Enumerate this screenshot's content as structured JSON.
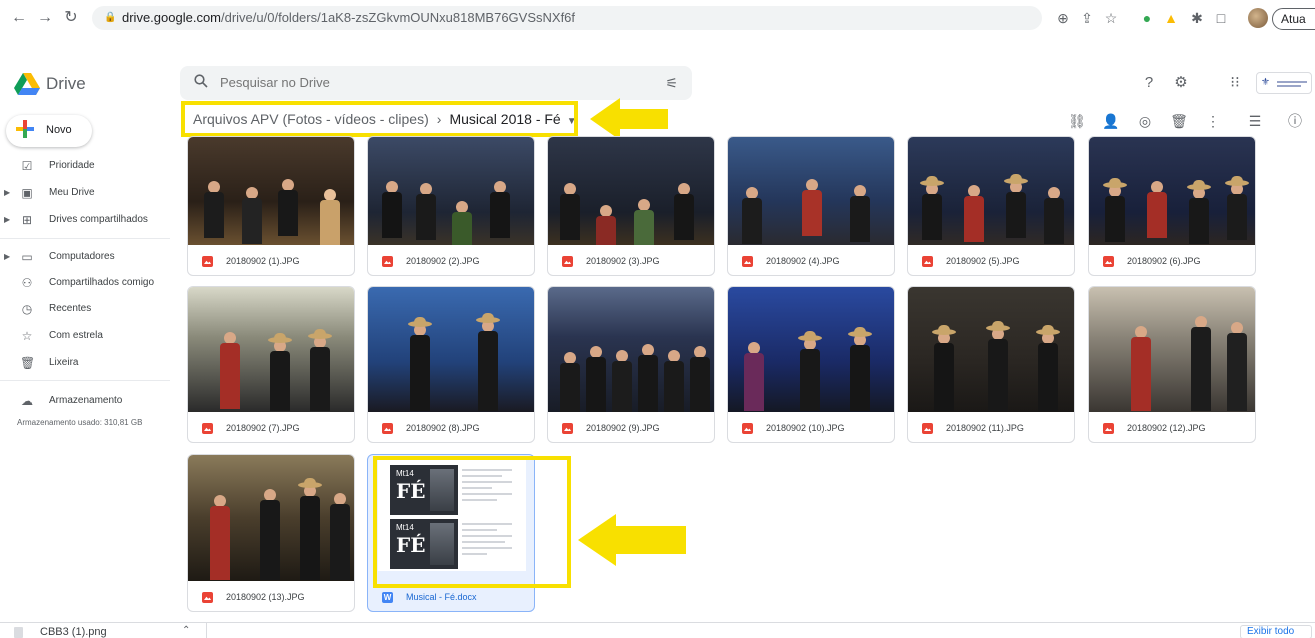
{
  "browser": {
    "url_domain": "drive.google.com",
    "url_path": "/drive/u/0/folders/1aK8-zsZGkvmOUNxu818MB76GVSsNXf6f",
    "update_label": "Atua"
  },
  "drive": {
    "app_name": "Drive",
    "search_placeholder": "Pesquisar no Drive"
  },
  "breadcrumb": {
    "parent": "Arquivos APV (Fotos - vídeos - clipes)",
    "separator": "›",
    "current": "Musical 2018 - Fé"
  },
  "sidebar": {
    "new_label": "Novo",
    "items": [
      {
        "label": "Prioridade",
        "icon": "check-circle-icon"
      },
      {
        "label": "Meu Drive",
        "icon": "drive-folder-icon"
      },
      {
        "label": "Drives compartilhados",
        "icon": "shared-drive-icon"
      },
      {
        "label": "Computadores",
        "icon": "computer-icon"
      },
      {
        "label": "Compartilhados comigo",
        "icon": "people-icon"
      },
      {
        "label": "Recentes",
        "icon": "clock-icon"
      },
      {
        "label": "Com estrela",
        "icon": "star-icon"
      },
      {
        "label": "Lixeira",
        "icon": "trash-icon"
      },
      {
        "label": "Armazenamento",
        "icon": "cloud-icon"
      }
    ],
    "storage_used": "Armazenamento usado: 310,81 GB"
  },
  "files": [
    {
      "name": "20180902 (1).JPG",
      "type": "image"
    },
    {
      "name": "20180902 (2).JPG",
      "type": "image"
    },
    {
      "name": "20180902 (3).JPG",
      "type": "image"
    },
    {
      "name": "20180902 (4).JPG",
      "type": "image"
    },
    {
      "name": "20180902 (5).JPG",
      "type": "image"
    },
    {
      "name": "20180902 (6).JPG",
      "type": "image"
    },
    {
      "name": "20180902 (7).JPG",
      "type": "image"
    },
    {
      "name": "20180902 (8).JPG",
      "type": "image"
    },
    {
      "name": "20180902 (9).JPG",
      "type": "image"
    },
    {
      "name": "20180902 (10).JPG",
      "type": "image"
    },
    {
      "name": "20180902 (11).JPG",
      "type": "image"
    },
    {
      "name": "20180902 (12).JPG",
      "type": "image"
    },
    {
      "name": "20180902 (13).JPG",
      "type": "image"
    },
    {
      "name": "Musical - Fé.docx",
      "type": "word",
      "icon_letter": "W",
      "selected": true
    }
  ],
  "doc_thumb": {
    "small_text": "Mt14",
    "big_text": "FÉ"
  },
  "download_bar": {
    "file_name": "CBB3 (1).png",
    "show_all_label": "Exibir todo"
  },
  "colors": {
    "highlight": "#f8e000",
    "selected_card_bg": "#e8f0fe",
    "image_icon": "#ea4335",
    "word_icon": "#4285f4"
  }
}
